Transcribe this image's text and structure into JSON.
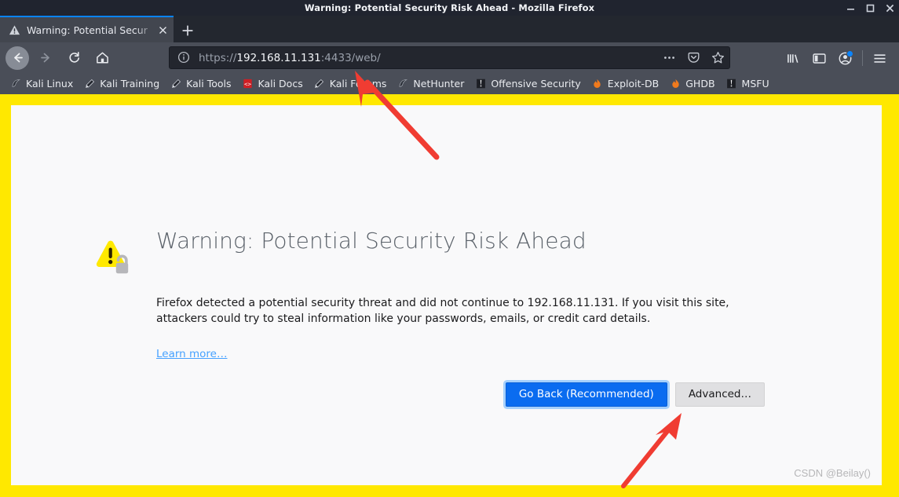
{
  "window": {
    "title": "Warning: Potential Security Risk Ahead - Mozilla Firefox",
    "controls": {
      "minimize": "minimize-window",
      "maximize": "maximize-window",
      "close": "close-window"
    }
  },
  "tabs": {
    "active": {
      "title": "Warning: Potential Secur",
      "favicon": "warning-triangle-icon",
      "close_label": "×"
    },
    "new_tab_label": "+"
  },
  "toolbar": {
    "back": "back-arrow-icon",
    "forward": "forward-arrow-icon",
    "reload": "reload-icon",
    "home": "home-icon",
    "url": {
      "scheme": "https://",
      "host": "192.168.11.131",
      "rest": ":4433/web/",
      "full": "https://192.168.11.131:4433/web/",
      "identity_icon": "info-circle-icon",
      "page_actions_icon": "ellipsis-icon",
      "pocket_icon": "pocket-icon",
      "bookmark_icon": "star-icon"
    },
    "library_icon": "library-icon",
    "sidebar_icon": "sidebar-icon",
    "account_icon": "account-avatar-icon",
    "menu_icon": "hamburger-menu-icon"
  },
  "bookmarks": [
    {
      "label": "Kali Linux",
      "icon": "kali-dragon-icon"
    },
    {
      "label": "Kali Training",
      "icon": "wrench-icon"
    },
    {
      "label": "Kali Tools",
      "icon": "wrench-icon"
    },
    {
      "label": "Kali Docs",
      "icon": "kali-docs-icon"
    },
    {
      "label": "Kali Forums",
      "icon": "wrench-icon"
    },
    {
      "label": "NetHunter",
      "icon": "kali-dragon-icon"
    },
    {
      "label": "Offensive Security",
      "icon": "offsec-icon"
    },
    {
      "label": "Exploit-DB",
      "icon": "flame-icon"
    },
    {
      "label": "GHDB",
      "icon": "flame-icon"
    },
    {
      "label": "MSFU",
      "icon": "offsec-icon"
    }
  ],
  "page": {
    "icon": "warning-triangle-unlocked-padlock-icon",
    "title": "Warning: Potential Security Risk Ahead",
    "paragraph": "Firefox detected a potential security threat and did not continue to 192.168.11.131. If you visit this site, attackers could try to steal information like your passwords, emails, or credit card details.",
    "learn_more": "Learn more…",
    "go_back_button": "Go Back (Recommended)",
    "advanced_button": "Advanced…"
  },
  "watermark": "CSDN @Beilay()",
  "colors": {
    "accent_blue": "#0a6cf0",
    "link_blue": "#45a1ff",
    "warning_yellow": "#ffe800",
    "annotation_red": "#f03c32",
    "chrome_dark": "#4a4e58",
    "titlebar": "#20242f",
    "page_bg": "#f9f9fa"
  }
}
